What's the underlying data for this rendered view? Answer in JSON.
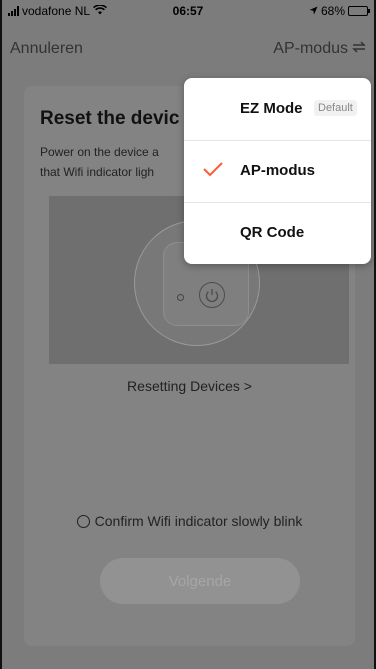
{
  "status_bar": {
    "carrier": "vodafone NL",
    "time": "06:57",
    "battery_percent": "68%",
    "battery_level": 0.68
  },
  "nav": {
    "cancel_label": "Annuleren",
    "mode_label": "AP-modus"
  },
  "card": {
    "title": "Reset the devic",
    "description_line1": "Power on the device a",
    "description_line2": "that Wifi indicator ligh",
    "reset_link": "Resetting Devices >",
    "confirm_label": "Confirm Wifi indicator slowly blink",
    "next_button": "Volgende"
  },
  "dropdown": {
    "items": [
      {
        "label": "EZ Mode",
        "badge": "Default",
        "selected": false
      },
      {
        "label": "AP-modus",
        "badge": "",
        "selected": true
      },
      {
        "label": "QR Code",
        "badge": "",
        "selected": false
      }
    ]
  },
  "colors": {
    "accent": "#ff5a36",
    "overlay": "#7c7c7c"
  },
  "icons": {
    "wifi": "wifi-icon",
    "location": "location-arrow-icon",
    "swap": "swap-arrows-icon",
    "power": "power-icon",
    "check": "check-icon"
  }
}
